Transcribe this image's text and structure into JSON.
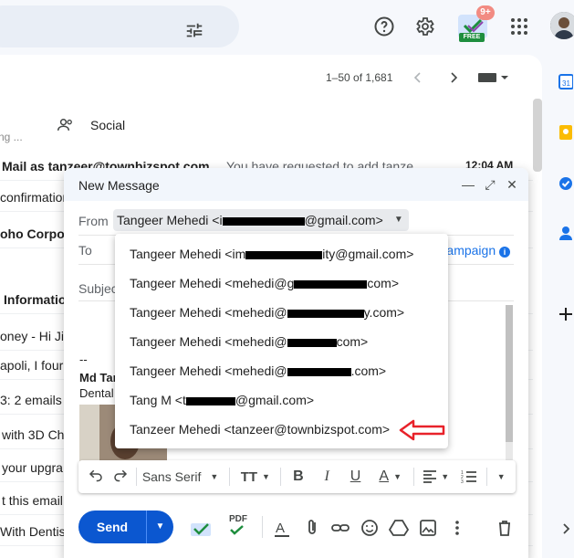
{
  "topbar": {
    "free_badge_count": "9+",
    "free_label": "FREE"
  },
  "maillist": {
    "pager": "1–50 of 1,681",
    "social_tab": "Social",
    "partial_text": "ng ...",
    "rows": [
      {
        "sender": "Mail as tanzeer@townbizspot.com",
        "snippet": "You have requested to add tanze",
        "time": "12:04 AM"
      },
      {
        "sender": "confirmation",
        "snippet": "",
        "time": ""
      },
      {
        "sender": "oho Corpo",
        "snippet": "",
        "time": ""
      },
      {
        "sender": "",
        "snippet": "",
        "time": ""
      },
      {
        "sender": "Informatio",
        "snippet": "",
        "time": ""
      },
      {
        "sender": "oney - Hi Jill",
        "snippet": "",
        "time": ""
      },
      {
        "sender": "apoli, I four",
        "snippet": "",
        "time": ""
      },
      {
        "sender": "3: 2 emails",
        "snippet": "",
        "time": ""
      },
      {
        "sender": "with 3D Ch",
        "snippet": "",
        "time": ""
      },
      {
        "sender": "your upgra",
        "snippet": "",
        "time": ""
      },
      {
        "sender": "t this email",
        "snippet": "",
        "time": ""
      },
      {
        "sender": "With Dentis",
        "snippet": "",
        "time": ""
      }
    ]
  },
  "compose": {
    "title": "New Message",
    "from_label": "From",
    "from_value_prefix": "Tangeer Mehedi <i",
    "from_value_suffix": "@gmail.com>",
    "to_label": "To",
    "campaign_label": "ampaign",
    "subject_placeholder": "Subjec",
    "signature_dash": "--",
    "signature_name": "Md Tan",
    "signature_dept": "Dental",
    "font_name": "Sans Serif",
    "send_label": "Send",
    "pdf_label": "PDF"
  },
  "dropdown": {
    "items": [
      {
        "pre": "Tangeer Mehedi <im",
        "post": "ity@gmail.com>"
      },
      {
        "pre": "Tangeer Mehedi <mehedi@g",
        "post": "com>"
      },
      {
        "pre": "Tangeer Mehedi <mehedi@",
        "post": "y.com>"
      },
      {
        "pre": "Tangeer Mehedi <mehedi@",
        "post": "com>"
      },
      {
        "pre": "Tangeer Mehedi <mehedi@",
        "post": ".com>"
      },
      {
        "pre": "Tang M <t",
        "post": "@gmail.com>"
      },
      {
        "pre": "Tanzeer Mehedi <tanzeer@townbizspot.com>",
        "post": ""
      }
    ]
  },
  "colors": {
    "accent": "#0b57d0",
    "arrow": "#e8222a",
    "chip": "#e8eaed"
  }
}
